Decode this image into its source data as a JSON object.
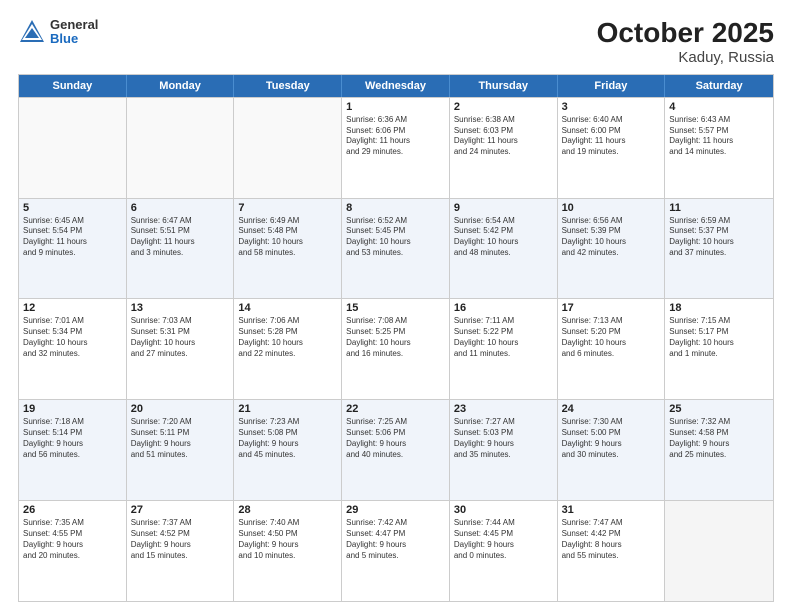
{
  "logo": {
    "general": "General",
    "blue": "Blue"
  },
  "title": "October 2025",
  "subtitle": "Kaduy, Russia",
  "days": [
    "Sunday",
    "Monday",
    "Tuesday",
    "Wednesday",
    "Thursday",
    "Friday",
    "Saturday"
  ],
  "weeks": [
    [
      {
        "day": "",
        "info": ""
      },
      {
        "day": "",
        "info": ""
      },
      {
        "day": "",
        "info": ""
      },
      {
        "day": "1",
        "info": "Sunrise: 6:36 AM\nSunset: 6:06 PM\nDaylight: 11 hours\nand 29 minutes."
      },
      {
        "day": "2",
        "info": "Sunrise: 6:38 AM\nSunset: 6:03 PM\nDaylight: 11 hours\nand 24 minutes."
      },
      {
        "day": "3",
        "info": "Sunrise: 6:40 AM\nSunset: 6:00 PM\nDaylight: 11 hours\nand 19 minutes."
      },
      {
        "day": "4",
        "info": "Sunrise: 6:43 AM\nSunset: 5:57 PM\nDaylight: 11 hours\nand 14 minutes."
      }
    ],
    [
      {
        "day": "5",
        "info": "Sunrise: 6:45 AM\nSunset: 5:54 PM\nDaylight: 11 hours\nand 9 minutes."
      },
      {
        "day": "6",
        "info": "Sunrise: 6:47 AM\nSunset: 5:51 PM\nDaylight: 11 hours\nand 3 minutes."
      },
      {
        "day": "7",
        "info": "Sunrise: 6:49 AM\nSunset: 5:48 PM\nDaylight: 10 hours\nand 58 minutes."
      },
      {
        "day": "8",
        "info": "Sunrise: 6:52 AM\nSunset: 5:45 PM\nDaylight: 10 hours\nand 53 minutes."
      },
      {
        "day": "9",
        "info": "Sunrise: 6:54 AM\nSunset: 5:42 PM\nDaylight: 10 hours\nand 48 minutes."
      },
      {
        "day": "10",
        "info": "Sunrise: 6:56 AM\nSunset: 5:39 PM\nDaylight: 10 hours\nand 42 minutes."
      },
      {
        "day": "11",
        "info": "Sunrise: 6:59 AM\nSunset: 5:37 PM\nDaylight: 10 hours\nand 37 minutes."
      }
    ],
    [
      {
        "day": "12",
        "info": "Sunrise: 7:01 AM\nSunset: 5:34 PM\nDaylight: 10 hours\nand 32 minutes."
      },
      {
        "day": "13",
        "info": "Sunrise: 7:03 AM\nSunset: 5:31 PM\nDaylight: 10 hours\nand 27 minutes."
      },
      {
        "day": "14",
        "info": "Sunrise: 7:06 AM\nSunset: 5:28 PM\nDaylight: 10 hours\nand 22 minutes."
      },
      {
        "day": "15",
        "info": "Sunrise: 7:08 AM\nSunset: 5:25 PM\nDaylight: 10 hours\nand 16 minutes."
      },
      {
        "day": "16",
        "info": "Sunrise: 7:11 AM\nSunset: 5:22 PM\nDaylight: 10 hours\nand 11 minutes."
      },
      {
        "day": "17",
        "info": "Sunrise: 7:13 AM\nSunset: 5:20 PM\nDaylight: 10 hours\nand 6 minutes."
      },
      {
        "day": "18",
        "info": "Sunrise: 7:15 AM\nSunset: 5:17 PM\nDaylight: 10 hours\nand 1 minute."
      }
    ],
    [
      {
        "day": "19",
        "info": "Sunrise: 7:18 AM\nSunset: 5:14 PM\nDaylight: 9 hours\nand 56 minutes."
      },
      {
        "day": "20",
        "info": "Sunrise: 7:20 AM\nSunset: 5:11 PM\nDaylight: 9 hours\nand 51 minutes."
      },
      {
        "day": "21",
        "info": "Sunrise: 7:23 AM\nSunset: 5:08 PM\nDaylight: 9 hours\nand 45 minutes."
      },
      {
        "day": "22",
        "info": "Sunrise: 7:25 AM\nSunset: 5:06 PM\nDaylight: 9 hours\nand 40 minutes."
      },
      {
        "day": "23",
        "info": "Sunrise: 7:27 AM\nSunset: 5:03 PM\nDaylight: 9 hours\nand 35 minutes."
      },
      {
        "day": "24",
        "info": "Sunrise: 7:30 AM\nSunset: 5:00 PM\nDaylight: 9 hours\nand 30 minutes."
      },
      {
        "day": "25",
        "info": "Sunrise: 7:32 AM\nSunset: 4:58 PM\nDaylight: 9 hours\nand 25 minutes."
      }
    ],
    [
      {
        "day": "26",
        "info": "Sunrise: 7:35 AM\nSunset: 4:55 PM\nDaylight: 9 hours\nand 20 minutes."
      },
      {
        "day": "27",
        "info": "Sunrise: 7:37 AM\nSunset: 4:52 PM\nDaylight: 9 hours\nand 15 minutes."
      },
      {
        "day": "28",
        "info": "Sunrise: 7:40 AM\nSunset: 4:50 PM\nDaylight: 9 hours\nand 10 minutes."
      },
      {
        "day": "29",
        "info": "Sunrise: 7:42 AM\nSunset: 4:47 PM\nDaylight: 9 hours\nand 5 minutes."
      },
      {
        "day": "30",
        "info": "Sunrise: 7:44 AM\nSunset: 4:45 PM\nDaylight: 9 hours\nand 0 minutes."
      },
      {
        "day": "31",
        "info": "Sunrise: 7:47 AM\nSunset: 4:42 PM\nDaylight: 8 hours\nand 55 minutes."
      },
      {
        "day": "",
        "info": ""
      }
    ]
  ]
}
